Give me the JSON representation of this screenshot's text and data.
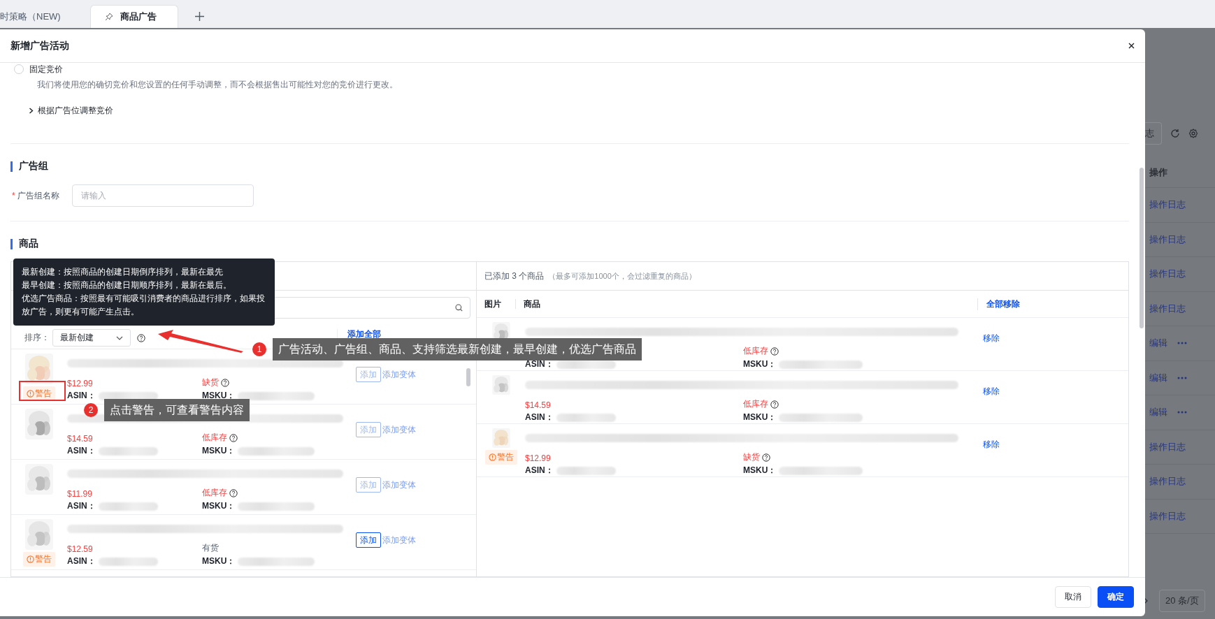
{
  "browser_tabs": [
    {
      "label": "时策略（NEW)",
      "selected": false,
      "pinned": false
    },
    {
      "label": "商品广告",
      "selected": true,
      "pinned": true
    }
  ],
  "background_table": {
    "toolbar_button": "志",
    "header": "操作",
    "rows": [
      {
        "kind": "log",
        "action": "操作日志"
      },
      {
        "kind": "log",
        "action": "操作日志"
      },
      {
        "kind": "log",
        "action": "操作日志"
      },
      {
        "kind": "log",
        "action": "操作日志"
      },
      {
        "kind": "edit",
        "action": "编辑"
      },
      {
        "kind": "edit",
        "action": "编辑"
      },
      {
        "kind": "edit",
        "action": "编辑"
      },
      {
        "kind": "log",
        "action": "操作日志"
      },
      {
        "kind": "log",
        "action": "操作日志"
      },
      {
        "kind": "log",
        "action": "操作日志"
      }
    ],
    "page_size": "20 条/页"
  },
  "modal": {
    "title": "新增广告活动",
    "bid_option": {
      "label": "固定竞价",
      "selected": false,
      "description": "我们将使用您的确切竞价和您设置的任何手动调整，而不会根据售出可能性对您的竞价进行更改。"
    },
    "expander": {
      "label": "根据广告位调整竞价",
      "expanded": false
    },
    "ad_group": {
      "heading": "广告组",
      "field_label": "广告组名称",
      "required": true,
      "required_mark": "*",
      "placeholder": "请输入"
    },
    "products": {
      "heading": "商品",
      "sort_label": "排序：",
      "sort_value": "最新创建",
      "add_all": "添加全部",
      "items": [
        {
          "price": "$12.99",
          "stock": "缺货",
          "in_stock": false,
          "warning": "警告",
          "asin_label": "ASIN：",
          "msku_label": "MSKU：",
          "add": "添加",
          "add_variant": "添加变体",
          "add_highlighted": false
        },
        {
          "price": "$14.59",
          "stock": "低库存",
          "in_stock": false,
          "asin_label": "ASIN：",
          "msku_label": "MSKU：",
          "add": "添加",
          "add_variant": "添加变体",
          "add_highlighted": false
        },
        {
          "price": "$11.99",
          "stock": "低库存",
          "in_stock": false,
          "asin_label": "ASIN：",
          "msku_label": "MSKU：",
          "add": "添加",
          "add_variant": "添加变体",
          "add_highlighted": false
        },
        {
          "price": "$12.59",
          "stock": "有货",
          "in_stock": true,
          "warning": "警告",
          "asin_label": "ASIN：",
          "msku_label": "MSKU：",
          "add": "添加",
          "add_variant": "添加变体",
          "add_highlighted": true
        }
      ],
      "added_summary": "已添加 3 个商品",
      "added_note": "（最多可添加1000个，会过滤重复的商品）",
      "columns": [
        "图片",
        "商品"
      ],
      "remove_all": "全部移除",
      "added": [
        {
          "stock": "低库存",
          "in_stock": false,
          "asin_label": "ASIN：",
          "msku_label": "MSKU：",
          "remove": "移除"
        },
        {
          "price": "$14.59",
          "stock": "低库存",
          "in_stock": false,
          "asin_label": "ASIN：",
          "msku_label": "MSKU：",
          "remove": "移除"
        },
        {
          "price": "$12.99",
          "stock": "缺货",
          "in_stock": false,
          "warning": "警告",
          "asin_label": "ASIN：",
          "msku_label": "MSKU：",
          "remove": "移除"
        }
      ]
    },
    "buttons": {
      "cancel": "取消",
      "ok": "确定"
    }
  },
  "tooltip": {
    "lines": [
      "最新创建：按照商品的创建日期倒序排列，最新在最先",
      "最早创建：按照商品的创建日期顺序排列，最新在最后。",
      "优选广告商品：按照最有可能吸引消费者的商品进行排序，如果投放广告，则更有可能产生点击。"
    ]
  },
  "annotations": [
    {
      "number": "1",
      "text": "广告活动、广告组、商品、支持筛选最新创建，最早创建，优选广告商品"
    },
    {
      "number": "2",
      "text": "点击警告，可查看警告内容"
    }
  ]
}
